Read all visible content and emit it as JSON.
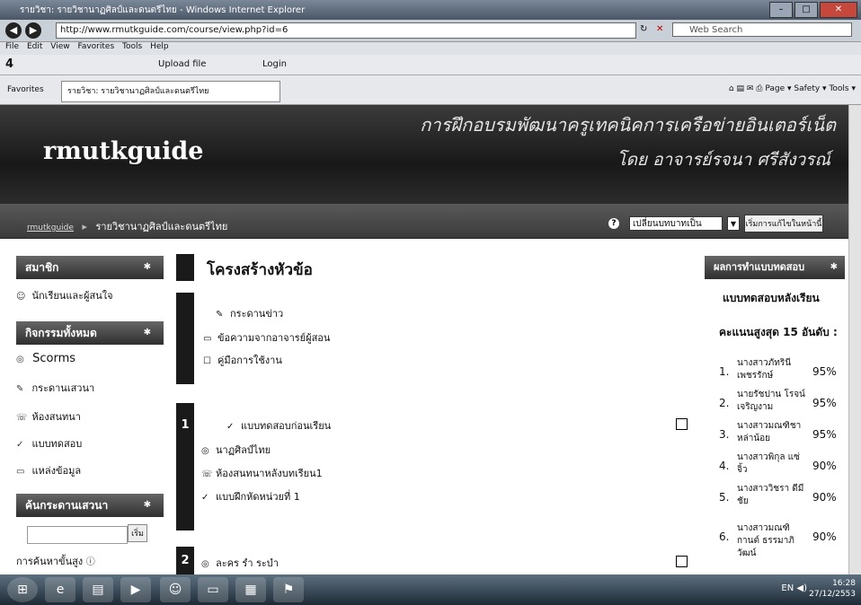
{
  "browser": {
    "title": "รายวิชา: รายวิชานาฏศิลป์และดนตรีไทย - Windows Internet Explorer",
    "url": "http://www.rmutkguide.com/course/view.php?id=6",
    "search_placeholder": "Web Search",
    "menu": [
      "File",
      "Edit",
      "View",
      "Favorites",
      "Tools",
      "Help"
    ],
    "toolbar_upload": "Upload file",
    "toolbar_login": "Login",
    "favorites_label": "Favorites",
    "tab_title": "รายวิชา: รายวิชานาฏศิลป์และดนตรีไทย",
    "command_items": [
      "Page",
      "Safety",
      "Tools"
    ]
  },
  "site": {
    "logo": "rmutkguide",
    "headline": "การฝึกอบรมพัฒนาครูเทคนิคการเครือข่ายอินเตอร์เน็ต",
    "byline": "โดย อาจารย์รจนา ศรีสังวรณ์"
  },
  "navbar": {
    "home": "rmutkguide",
    "course": "รายวิชานาฏศิลป์และดนตรีไทย",
    "role_select": "เปลี่ยนบทบาทเป็น",
    "edit_button": "เริ่มการแก้ไขในหน้านี้"
  },
  "sidebar": {
    "members_title": "สมาชิก",
    "members_item": "นักเรียนและผู้สนใจ",
    "activities_title": "กิจกรรมทั้งหมด",
    "activities": [
      "Scorms",
      "กระดานเสวนา",
      "ห้องสนทนา",
      "แบบทดสอบ",
      "แหล่งข้อมูล"
    ],
    "search_title": "ค้นกระดานเสวนา",
    "search_go": "เริ่ม",
    "advanced_search": "การค้นหาขั้นสูง"
  },
  "main": {
    "title": "โครงสร้างหัวข้อ",
    "section0": [
      "กระดานข่าว",
      "ข้อความจากอาจารย์ผู้สอน",
      "คู่มือการใช้งาน"
    ],
    "section1_num": "1",
    "section1": [
      "แบบทดสอบก่อนเรียน",
      "นาฏศิลป์ไทย",
      "ห้องสนทนาหลังบทเรียน1",
      "แบบฝึกหัดหน่วยที่ 1"
    ],
    "section2_num": "2",
    "section2": [
      "ละคร รำ ระบำ"
    ]
  },
  "quiz_block": {
    "title": "ผลการทำแบบทดสอบ",
    "quiz_name": "แบบทดสอบหลังเรียน",
    "max_score": "คะแนนสูงสุด 15 อันดับ :",
    "ranks": [
      {
        "n": "1.",
        "name": "นางสาวภัทรินี เพชรรักษ์",
        "score": "95%"
      },
      {
        "n": "2.",
        "name": "นายรัชปาน โรจน์เจริญงาม",
        "score": "95%"
      },
      {
        "n": "3.",
        "name": "นางสาวมณฑิชา หล่าน้อย",
        "score": "95%"
      },
      {
        "n": "4.",
        "name": "นางสาวพิกุล แซ่จิ้ว",
        "score": "90%"
      },
      {
        "n": "5.",
        "name": "นางสาววิชรา ดีมีชัย",
        "score": "90%"
      },
      {
        "n": "6.",
        "name": "นางสาวมณฑิกานต์ ธรรมาภิวัฒน์",
        "score": "90%"
      }
    ]
  },
  "taskbar": {
    "lang": "EN",
    "time": "16:28",
    "date": "27/12/2553"
  }
}
